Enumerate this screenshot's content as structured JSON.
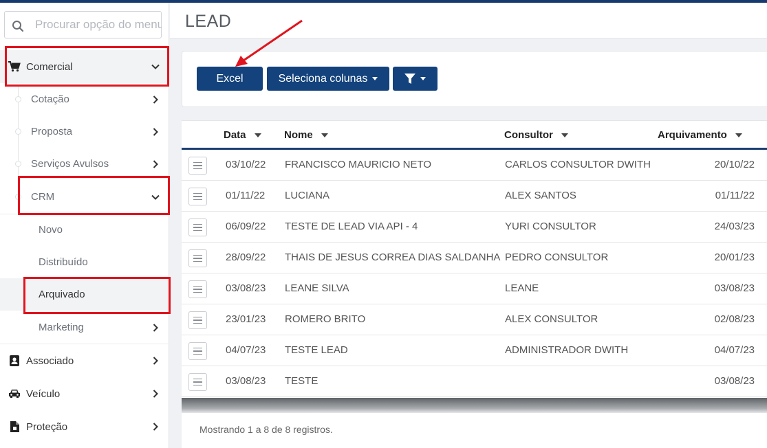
{
  "search": {
    "placeholder": "Procurar opção do menu"
  },
  "sidebar": {
    "comercial": "Comercial",
    "cotacao": "Cotação",
    "proposta": "Proposta",
    "servicos": "Serviços Avulsos",
    "crm": "CRM",
    "novo": "Novo",
    "distribuido": "Distribuído",
    "arquivado": "Arquivado",
    "marketing": "Marketing",
    "associado": "Associado",
    "veiculo": "Veículo",
    "protecao": "Proteção"
  },
  "page": {
    "title": "LEAD"
  },
  "toolbar": {
    "excel": "Excel",
    "columns": "Seleciona colunas"
  },
  "table": {
    "headers": {
      "data": "Data",
      "nome": "Nome",
      "consultor": "Consultor",
      "arquivamento": "Arquivamento"
    },
    "rows": [
      {
        "data": "03/10/22",
        "nome": "FRANCISCO MAURICIO NETO",
        "consultor": "CARLOS CONSULTOR DWITH",
        "arquivamento": "20/10/22"
      },
      {
        "data": "01/11/22",
        "nome": "LUCIANA",
        "consultor": "ALEX SANTOS",
        "arquivamento": "01/11/22"
      },
      {
        "data": "06/09/22",
        "nome": "TESTE DE LEAD VIA API - 4",
        "consultor": "YURI CONSULTOR",
        "arquivamento": "24/03/23"
      },
      {
        "data": "28/09/22",
        "nome": "THAIS DE JESUS CORREA DIAS SALDANHA",
        "consultor": "PEDRO CONSULTOR",
        "arquivamento": "20/01/23"
      },
      {
        "data": "03/08/23",
        "nome": "LEANE SILVA",
        "consultor": "LEANE",
        "arquivamento": "03/08/23"
      },
      {
        "data": "23/01/23",
        "nome": "ROMERO BRITO",
        "consultor": "ALEX CONSULTOR",
        "arquivamento": "02/08/23"
      },
      {
        "data": "04/07/23",
        "nome": "TESTE LEAD",
        "consultor": "ADMINISTRADOR DWITH",
        "arquivamento": "04/07/23"
      },
      {
        "data": "03/08/23",
        "nome": "TESTE",
        "consultor": "",
        "arquivamento": "03/08/23"
      }
    ],
    "footer": "Mostrando 1 a 8 de 8 registros."
  },
  "colors": {
    "primary": "#13427c",
    "highlight": "#e0141e"
  }
}
